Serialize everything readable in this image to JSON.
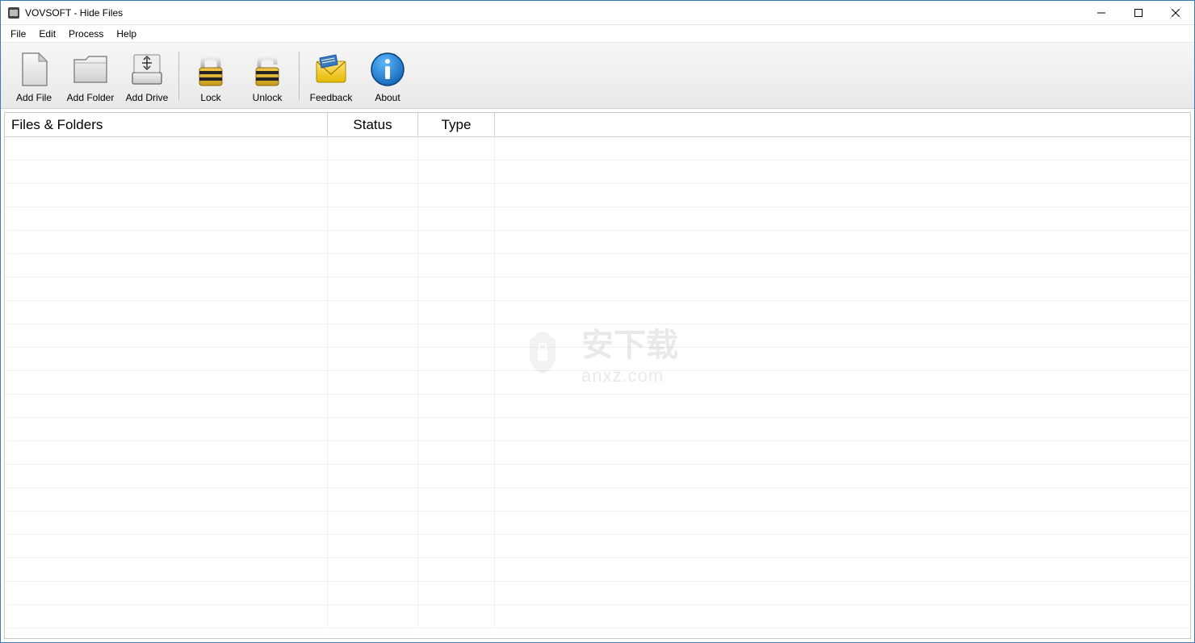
{
  "titlebar": {
    "title": "VOVSOFT - Hide Files"
  },
  "menubar": {
    "items": [
      "File",
      "Edit",
      "Process",
      "Help"
    ]
  },
  "toolbar": {
    "buttons": [
      {
        "id": "add-file",
        "label": "Add File"
      },
      {
        "id": "add-folder",
        "label": "Add Folder"
      },
      {
        "id": "add-drive",
        "label": "Add Drive"
      },
      {
        "sep": true
      },
      {
        "id": "lock",
        "label": "Lock"
      },
      {
        "id": "unlock",
        "label": "Unlock"
      },
      {
        "sep": true
      },
      {
        "id": "feedback",
        "label": "Feedback"
      },
      {
        "id": "about",
        "label": "About"
      }
    ]
  },
  "table": {
    "columns": {
      "files_folders": "Files & Folders",
      "status": "Status",
      "type": "Type"
    },
    "rows": []
  },
  "watermark": {
    "main": "安下载",
    "sub": "anxz.com"
  }
}
